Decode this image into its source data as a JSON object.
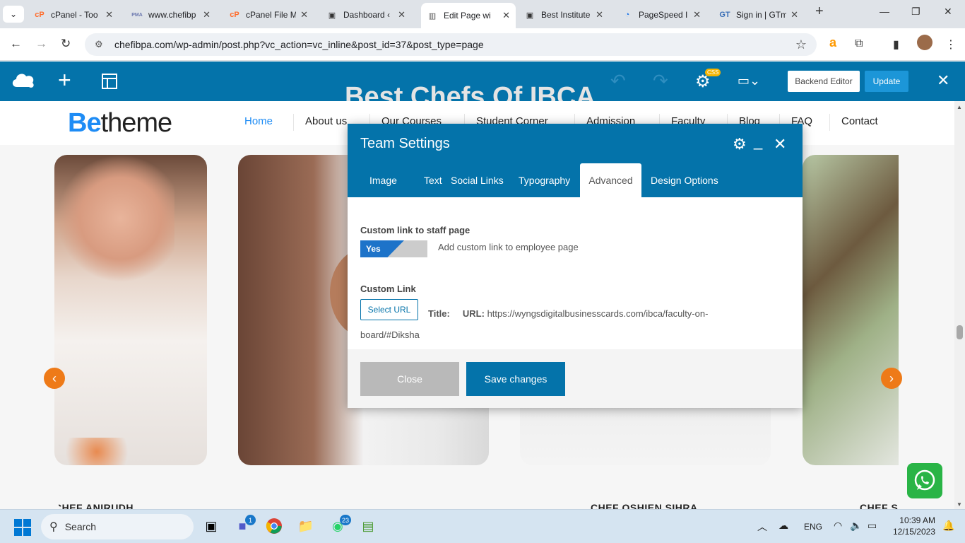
{
  "browser": {
    "tabs": [
      {
        "title": "cPanel - Too",
        "icon": "cpanel-icon",
        "icon_glyph": "cP",
        "icon_color": "#ff6c2c"
      },
      {
        "title": "www.chefibp",
        "icon": "phpmyadmin-icon",
        "icon_glyph": "PMA",
        "icon_color": "#6c78af"
      },
      {
        "title": "cPanel File M",
        "icon": "cpanel-icon",
        "icon_glyph": "cP",
        "icon_color": "#ff6c2c"
      },
      {
        "title": "Dashboard ‹",
        "icon": "dashboard-icon",
        "icon_glyph": "▣",
        "icon_color": "#333333"
      },
      {
        "title": "Edit Page wi",
        "icon": "wpbakery-icon",
        "icon_glyph": "▥",
        "icon_color": "#555555"
      },
      {
        "title": "Best Institute",
        "icon": "dashboard-icon",
        "icon_glyph": "▣",
        "icon_color": "#333333"
      },
      {
        "title": "PageSpeed I",
        "icon": "pagespeed-icon",
        "icon_glyph": "◔",
        "icon_color": "#1a73e8"
      },
      {
        "title": "Sign in | GTm",
        "icon": "gtmetrix-icon",
        "icon_glyph": "GT",
        "icon_color": "#3b6fb6"
      }
    ],
    "active_tab_index": 4,
    "url": "chefibpa.com/wp-admin/post.php?vc_action=vc_inline&post_id=37&post_type=page"
  },
  "builder": {
    "css_badge": "CSS",
    "backend_editor_label": "Backend Editor",
    "update_label": "Update"
  },
  "site": {
    "logo_be": "Be",
    "logo_theme": "theme",
    "ghost_title": "Best Chefs Of IBCA",
    "menu": [
      "Home",
      "About us",
      "Our Courses",
      "Student Corner",
      "Admission",
      "Faculty",
      "Blog",
      "FAQ",
      "Contact"
    ],
    "active_menu": "Home",
    "chef_names": [
      "CHEF ANIRUDH",
      "CHEF OSHIEN SIHRA",
      "CHEF S"
    ]
  },
  "modal": {
    "title": "Team Settings",
    "tabs": [
      "Image",
      "Text",
      "Social Links",
      "Typography",
      "Advanced",
      "Design Options"
    ],
    "active_tab": "Advanced",
    "custom_link_staff_label": "Custom link to staff page",
    "toggle_value": "Yes",
    "toggle_on": true,
    "toggle_description": "Add custom link to employee page",
    "custom_link_label": "Custom Link",
    "select_url_label": "Select URL",
    "title_label": "Title:",
    "url_label": "URL:",
    "url_value": "https://wyngsdigitalbusinesscards.com/ibca/faculty-on-board/#Diksha",
    "close_label": "Close",
    "save_label": "Save changes"
  },
  "taskbar": {
    "search_placeholder": "Search",
    "badges": {
      "teams": "1",
      "whatsapp": "23"
    },
    "language": "ENG",
    "time": "10:39 AM",
    "date": "12/15/2023"
  }
}
